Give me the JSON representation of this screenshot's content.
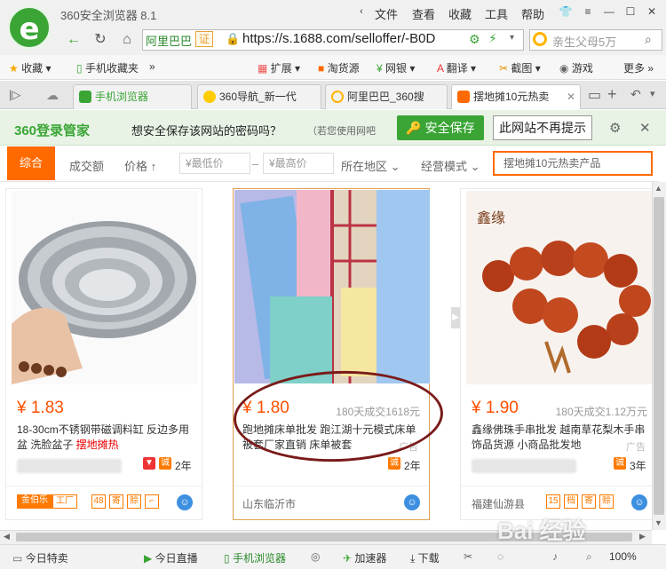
{
  "browser": {
    "title": "360安全浏览器 8.1",
    "menu": [
      "文件",
      "查看",
      "收藏",
      "工具",
      "帮助"
    ],
    "url_site": "阿里巴巴",
    "url_cert": "证",
    "url": "https://s.1688.com/selloffer/-B0D",
    "search_placeholder": "亲生父母5万",
    "bookmarks": [
      "收藏",
      "手机收藏夹",
      "»",
      "扩展",
      "淘货源",
      "网银",
      "翻译",
      "截图",
      "游戏",
      "更多"
    ],
    "tabs": [
      {
        "label": "手机浏览器",
        "color": "#3aa535"
      },
      {
        "label": "360导航_新一代",
        "color": "#ffcc00"
      },
      {
        "label": "阿里巴巴_360搜",
        "color": "#ffcc00"
      },
      {
        "label": "摆地摊10元热卖",
        "color": "#ff6a00"
      }
    ]
  },
  "password_bar": {
    "brand": "360登录管家",
    "message": "想安全保存该网站的密码吗？",
    "hint": "（若您使用网吧",
    "save_label": "安全保存",
    "never_label": "此网站不再提示"
  },
  "filters": {
    "sort_default": "综合",
    "sort_volume": "成交额",
    "sort_price": "价格",
    "min_price": "¥最低价",
    "dash": "–",
    "max_price": "¥最高价",
    "region": "所在地区",
    "mode": "经营模式",
    "search_value": "摆地摊10元热卖产品"
  },
  "products": [
    {
      "price": "¥ 1.83",
      "sold": "",
      "desc_pre": "18-30cm不锈钢带磁调料缸 反边多用盆 洗脸盆子 ",
      "desc_kw": "摆地摊热",
      "ad": "",
      "years": "2年",
      "location": "",
      "tags": [
        "金伯乐",
        "工厂",
        "48",
        "寄",
        "赊"
      ]
    },
    {
      "price": "¥ 1.80",
      "sold": "180天成交1618元",
      "desc_pre": "跑地摊床单批发 跑江湖十元模式床单被套厂家直销 床单被套",
      "desc_kw": "",
      "ad": "广告",
      "years": "2年",
      "location": "山东临沂市",
      "tags": []
    },
    {
      "price": "¥ 1.90",
      "sold": "180天成交1.12万元",
      "desc_pre": "鑫缘佛珠手串批发 越南草花梨木手串饰品货源 小商品批发地",
      "desc_kw": "",
      "ad": "广告",
      "years": "3年",
      "location": "福建仙游县",
      "tags": [
        "15",
        "档",
        "寄",
        "赊"
      ]
    }
  ],
  "status": {
    "left": "今日特卖",
    "live": "今日直播",
    "mobile": "手机浏览器",
    "accel": "加速器",
    "download": "下载",
    "zoom": "100%"
  },
  "watermark": "Bai 经验"
}
